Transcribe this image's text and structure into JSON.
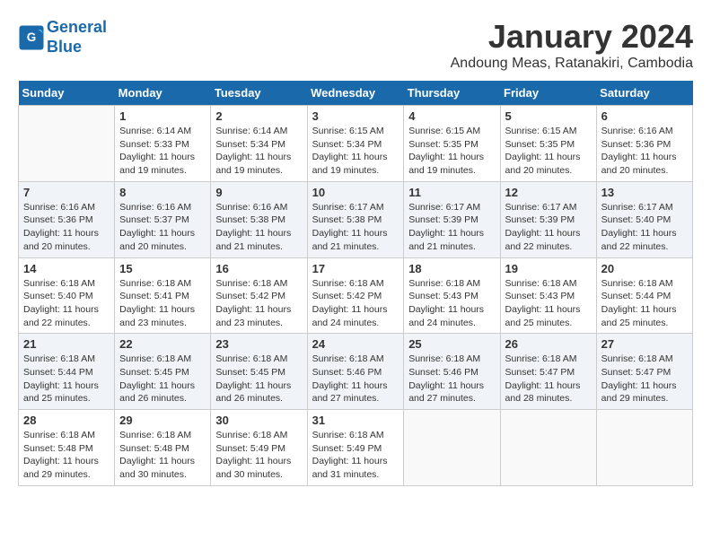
{
  "header": {
    "logo_line1": "General",
    "logo_line2": "Blue",
    "month": "January 2024",
    "location": "Andoung Meas, Ratanakiri, Cambodia"
  },
  "columns": [
    "Sunday",
    "Monday",
    "Tuesday",
    "Wednesday",
    "Thursday",
    "Friday",
    "Saturday"
  ],
  "weeks": [
    [
      {
        "day": "",
        "info": ""
      },
      {
        "day": "1",
        "info": "Sunrise: 6:14 AM\nSunset: 5:33 PM\nDaylight: 11 hours\nand 19 minutes."
      },
      {
        "day": "2",
        "info": "Sunrise: 6:14 AM\nSunset: 5:34 PM\nDaylight: 11 hours\nand 19 minutes."
      },
      {
        "day": "3",
        "info": "Sunrise: 6:15 AM\nSunset: 5:34 PM\nDaylight: 11 hours\nand 19 minutes."
      },
      {
        "day": "4",
        "info": "Sunrise: 6:15 AM\nSunset: 5:35 PM\nDaylight: 11 hours\nand 19 minutes."
      },
      {
        "day": "5",
        "info": "Sunrise: 6:15 AM\nSunset: 5:35 PM\nDaylight: 11 hours\nand 20 minutes."
      },
      {
        "day": "6",
        "info": "Sunrise: 6:16 AM\nSunset: 5:36 PM\nDaylight: 11 hours\nand 20 minutes."
      }
    ],
    [
      {
        "day": "7",
        "info": "Sunrise: 6:16 AM\nSunset: 5:36 PM\nDaylight: 11 hours\nand 20 minutes."
      },
      {
        "day": "8",
        "info": "Sunrise: 6:16 AM\nSunset: 5:37 PM\nDaylight: 11 hours\nand 20 minutes."
      },
      {
        "day": "9",
        "info": "Sunrise: 6:16 AM\nSunset: 5:38 PM\nDaylight: 11 hours\nand 21 minutes."
      },
      {
        "day": "10",
        "info": "Sunrise: 6:17 AM\nSunset: 5:38 PM\nDaylight: 11 hours\nand 21 minutes."
      },
      {
        "day": "11",
        "info": "Sunrise: 6:17 AM\nSunset: 5:39 PM\nDaylight: 11 hours\nand 21 minutes."
      },
      {
        "day": "12",
        "info": "Sunrise: 6:17 AM\nSunset: 5:39 PM\nDaylight: 11 hours\nand 22 minutes."
      },
      {
        "day": "13",
        "info": "Sunrise: 6:17 AM\nSunset: 5:40 PM\nDaylight: 11 hours\nand 22 minutes."
      }
    ],
    [
      {
        "day": "14",
        "info": "Sunrise: 6:18 AM\nSunset: 5:40 PM\nDaylight: 11 hours\nand 22 minutes."
      },
      {
        "day": "15",
        "info": "Sunrise: 6:18 AM\nSunset: 5:41 PM\nDaylight: 11 hours\nand 23 minutes."
      },
      {
        "day": "16",
        "info": "Sunrise: 6:18 AM\nSunset: 5:42 PM\nDaylight: 11 hours\nand 23 minutes."
      },
      {
        "day": "17",
        "info": "Sunrise: 6:18 AM\nSunset: 5:42 PM\nDaylight: 11 hours\nand 24 minutes."
      },
      {
        "day": "18",
        "info": "Sunrise: 6:18 AM\nSunset: 5:43 PM\nDaylight: 11 hours\nand 24 minutes."
      },
      {
        "day": "19",
        "info": "Sunrise: 6:18 AM\nSunset: 5:43 PM\nDaylight: 11 hours\nand 25 minutes."
      },
      {
        "day": "20",
        "info": "Sunrise: 6:18 AM\nSunset: 5:44 PM\nDaylight: 11 hours\nand 25 minutes."
      }
    ],
    [
      {
        "day": "21",
        "info": "Sunrise: 6:18 AM\nSunset: 5:44 PM\nDaylight: 11 hours\nand 25 minutes."
      },
      {
        "day": "22",
        "info": "Sunrise: 6:18 AM\nSunset: 5:45 PM\nDaylight: 11 hours\nand 26 minutes."
      },
      {
        "day": "23",
        "info": "Sunrise: 6:18 AM\nSunset: 5:45 PM\nDaylight: 11 hours\nand 26 minutes."
      },
      {
        "day": "24",
        "info": "Sunrise: 6:18 AM\nSunset: 5:46 PM\nDaylight: 11 hours\nand 27 minutes."
      },
      {
        "day": "25",
        "info": "Sunrise: 6:18 AM\nSunset: 5:46 PM\nDaylight: 11 hours\nand 27 minutes."
      },
      {
        "day": "26",
        "info": "Sunrise: 6:18 AM\nSunset: 5:47 PM\nDaylight: 11 hours\nand 28 minutes."
      },
      {
        "day": "27",
        "info": "Sunrise: 6:18 AM\nSunset: 5:47 PM\nDaylight: 11 hours\nand 29 minutes."
      }
    ],
    [
      {
        "day": "28",
        "info": "Sunrise: 6:18 AM\nSunset: 5:48 PM\nDaylight: 11 hours\nand 29 minutes."
      },
      {
        "day": "29",
        "info": "Sunrise: 6:18 AM\nSunset: 5:48 PM\nDaylight: 11 hours\nand 30 minutes."
      },
      {
        "day": "30",
        "info": "Sunrise: 6:18 AM\nSunset: 5:49 PM\nDaylight: 11 hours\nand 30 minutes."
      },
      {
        "day": "31",
        "info": "Sunrise: 6:18 AM\nSunset: 5:49 PM\nDaylight: 11 hours\nand 31 minutes."
      },
      {
        "day": "",
        "info": ""
      },
      {
        "day": "",
        "info": ""
      },
      {
        "day": "",
        "info": ""
      }
    ]
  ]
}
